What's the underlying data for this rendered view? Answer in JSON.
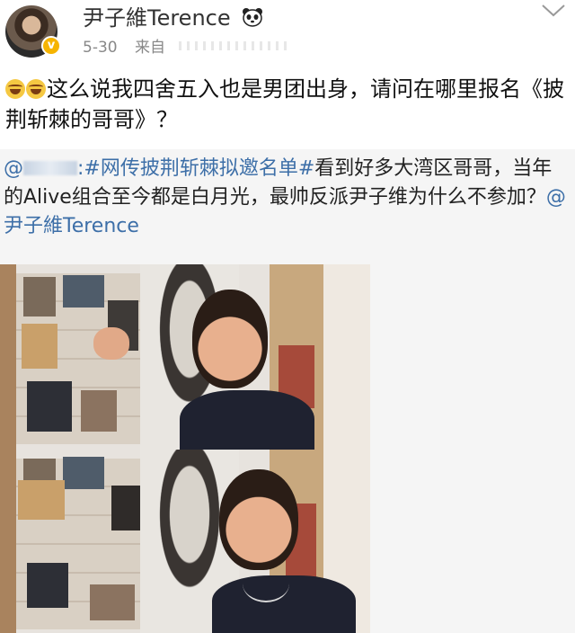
{
  "post": {
    "author": "尹子維Terence",
    "date": "5-30",
    "source_prefix": "来自",
    "text": "这么说我四舍五入也是男团出身，请问在哪里报名《披荆斩棘的哥哥》？"
  },
  "repost": {
    "at_prefix": "@",
    "hashtag": "#网传披荆斩棘拟邀名单#",
    "text": "看到好多大湾区哥哥，当年的Alive组合至今都是白月光，最帅反派尹子维为什么不参加？",
    "mention": "@尹子維Terence"
  },
  "icons": {
    "verified": "verified-badge-icon",
    "panda": "panda-icon",
    "emoji": "laugh-cry-emoji-icon",
    "menu": "chevron-down-icon"
  },
  "colors": {
    "link": "#3d6fa8",
    "verified": "#f6b400",
    "repost_bg": "#f5f5f5"
  }
}
